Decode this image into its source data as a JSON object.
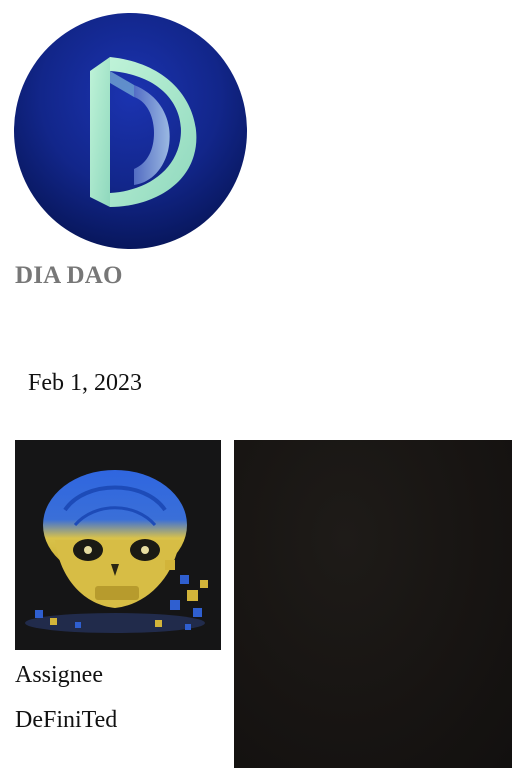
{
  "organization": {
    "name": "DIA DAO",
    "logo_icon": "dia-d-letter-icon",
    "logo_colors": [
      "#1a2fa0",
      "#081a5e",
      "#a8e6c6"
    ]
  },
  "entry": {
    "date": "Feb 1, 2023",
    "assignee_label": "Assignee",
    "assignee_name": "DeFiniTed",
    "avatar_icon": "skull-avatar-icon"
  }
}
